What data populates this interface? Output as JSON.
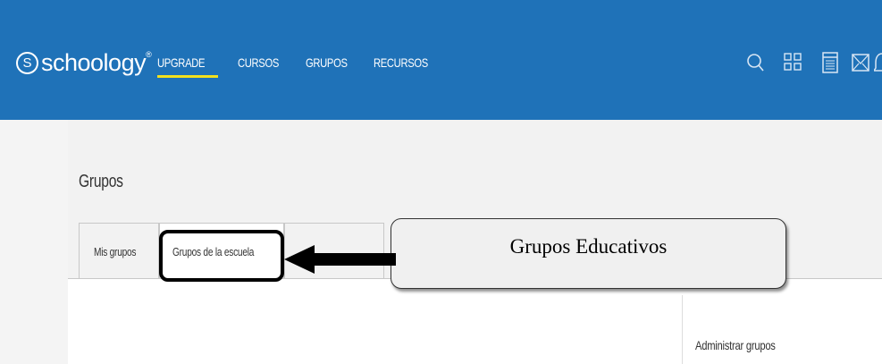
{
  "app": {
    "logo_text": "schoology",
    "logo_mark": "S",
    "logo_tm": "®"
  },
  "nav": {
    "items": [
      {
        "label": "UPGRADE",
        "active": true
      },
      {
        "label": "CURSOS",
        "active": false
      },
      {
        "label": "GRUPOS",
        "active": false
      },
      {
        "label": "RECURSOS",
        "active": false
      }
    ],
    "icons": [
      "search-icon",
      "apps-grid-icon",
      "calendar-icon",
      "messages-icon",
      "notifications-icon"
    ]
  },
  "page": {
    "title": "Grupos",
    "tabs": [
      {
        "label": "Mis grupos",
        "active": false
      },
      {
        "label": "Grupos de la escuela",
        "active": true
      },
      {
        "label": "",
        "active": false
      }
    ]
  },
  "sidebar": {
    "admin_link": "Administrar grupos"
  },
  "annotation": {
    "callout_text": "Grupos Educativos"
  },
  "colors": {
    "topbar": "#1f72b8",
    "active_underline": "#f2e01e",
    "highlight_border": "#000000",
    "callout_fill": "#f0f0f0"
  }
}
